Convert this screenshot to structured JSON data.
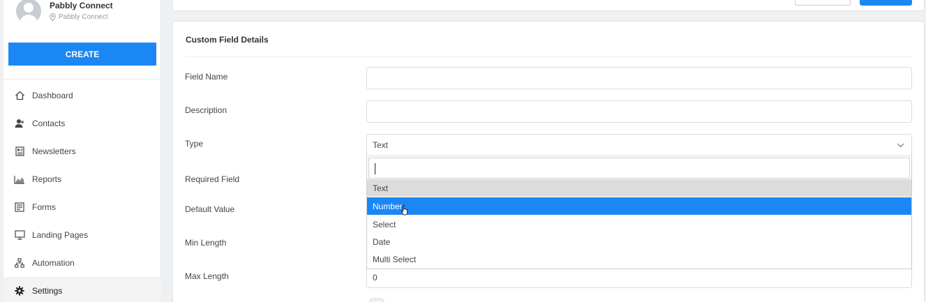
{
  "profile": {
    "name": "Pabbly Connect",
    "location": "Pabbly Connect"
  },
  "sidebar": {
    "create_label": "CREATE",
    "items": [
      {
        "label": "Dashboard",
        "icon": "home-icon"
      },
      {
        "label": "Contacts",
        "icon": "contacts-icon"
      },
      {
        "label": "Newsletters",
        "icon": "newsletter-icon"
      },
      {
        "label": "Reports",
        "icon": "reports-icon"
      },
      {
        "label": "Forms",
        "icon": "forms-icon"
      },
      {
        "label": "Landing Pages",
        "icon": "monitor-icon"
      },
      {
        "label": "Automation",
        "icon": "automation-icon"
      },
      {
        "label": "Settings",
        "icon": "gear-icon",
        "active": true
      }
    ]
  },
  "form": {
    "title": "Custom Field Details",
    "field_name_label": "Field Name",
    "field_name_value": "",
    "description_label": "Description",
    "description_value": "",
    "type_label": "Type",
    "type_value": "Text",
    "required_label": "Required Field",
    "default_label": "Default Value",
    "min_label": "Min Length",
    "max_label": "Max Length",
    "max_value": "0"
  },
  "dropdown": {
    "search_value": "",
    "options": [
      "Text",
      "Number",
      "Select",
      "Date",
      "Multi Select"
    ],
    "highlighted": "Text",
    "hovered": "Number"
  },
  "colors": {
    "accent": "#1b87f5",
    "highlight": "#dcdcdc"
  }
}
